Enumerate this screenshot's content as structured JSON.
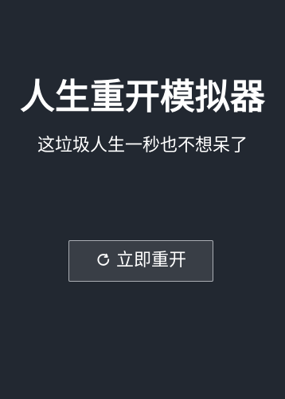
{
  "header": {
    "title": "人生重开模拟器",
    "subtitle": "这垃圾人生一秒也不想呆了"
  },
  "actions": {
    "restart_label": "立即重开",
    "restart_icon": "refresh-icon"
  },
  "colors": {
    "background": "#222831",
    "button_background": "#393e46",
    "button_border": "#a9adb3",
    "text": "#ffffff"
  }
}
